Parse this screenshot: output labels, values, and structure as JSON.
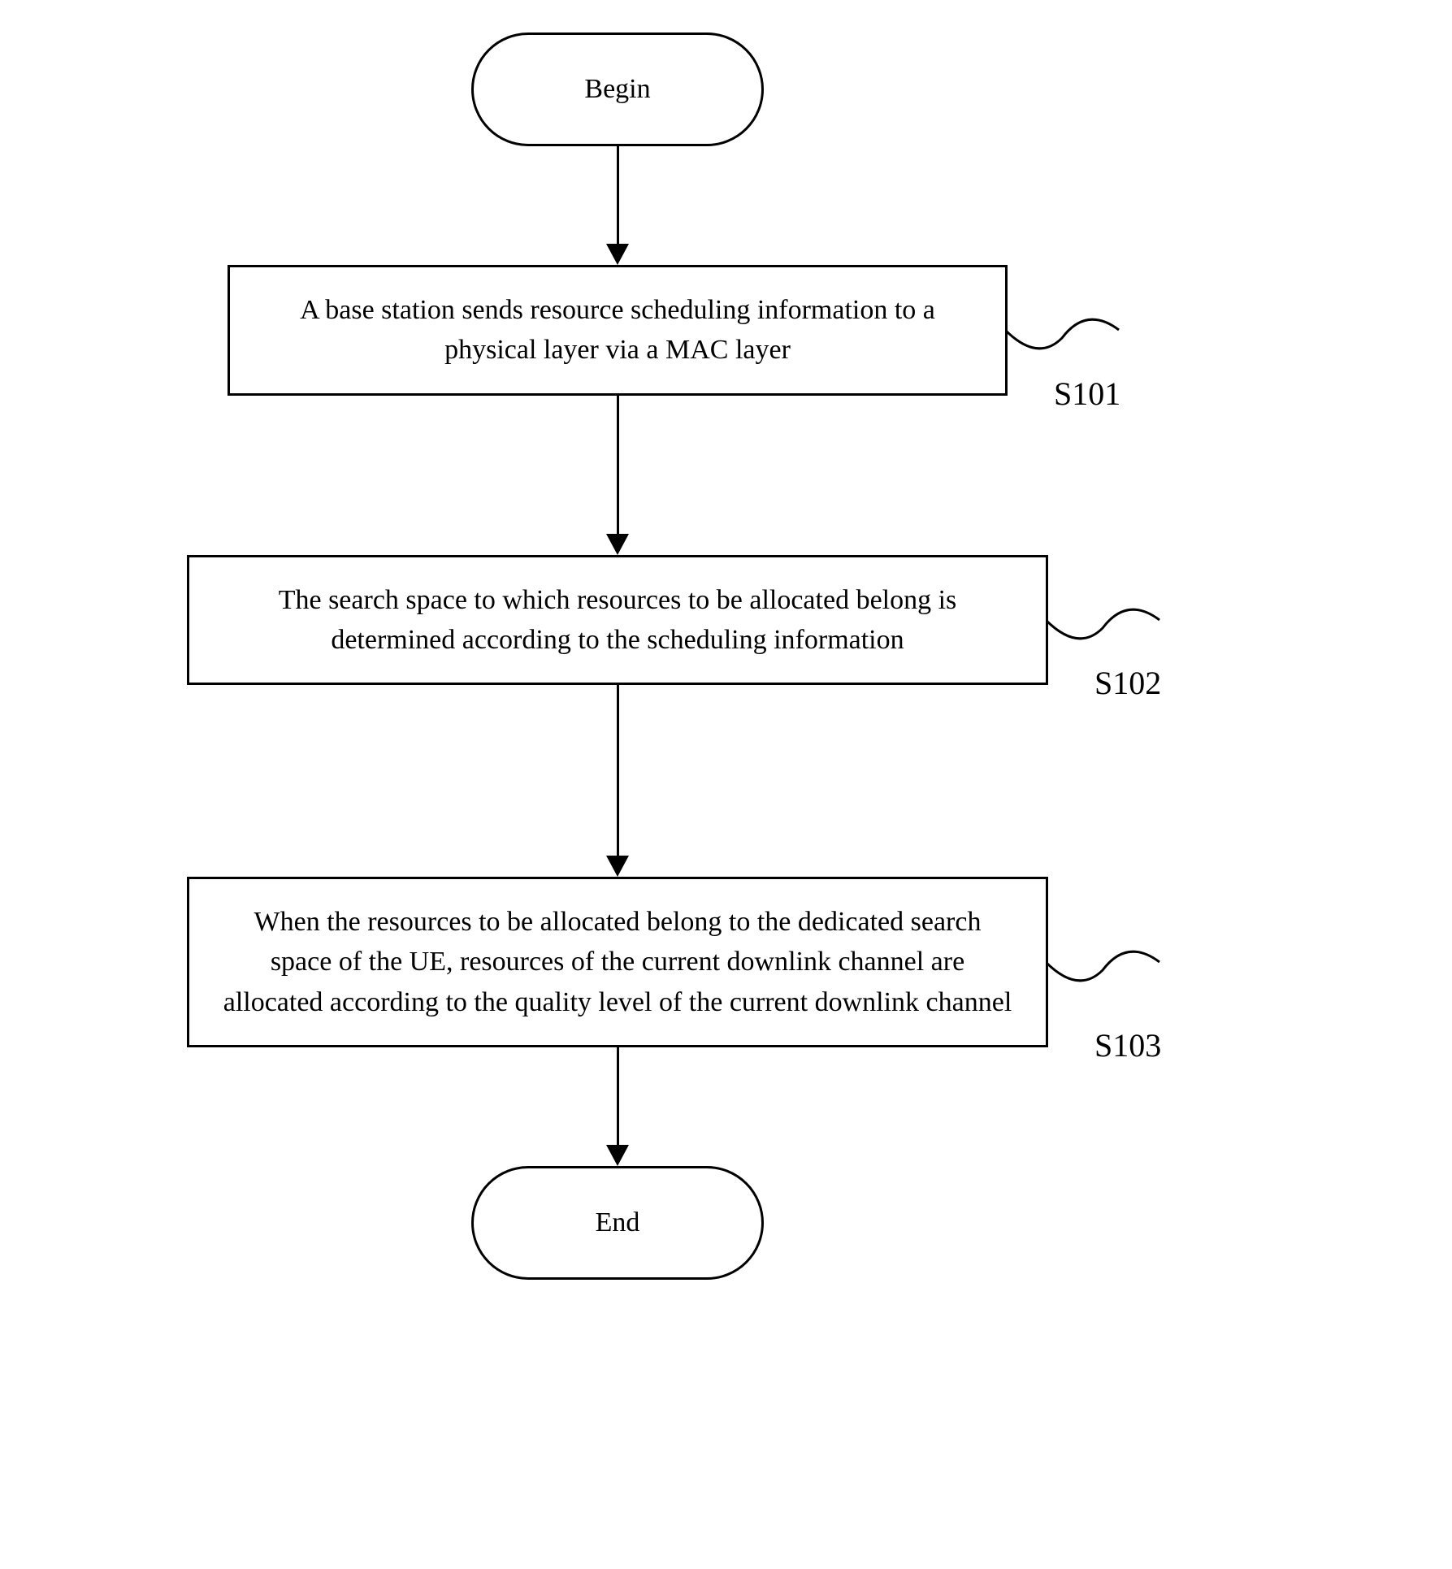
{
  "flow": {
    "begin": "Begin",
    "end": "End",
    "steps": [
      {
        "id": "S101",
        "text": "A base station sends resource scheduling information to a physical layer via a MAC layer"
      },
      {
        "id": "S102",
        "text": "The search space to which resources to be allocated belong is determined according to the scheduling information"
      },
      {
        "id": "S103",
        "text": "When the resources to be allocated belong to the dedicated search space of the UE, resources of the current downlink channel are allocated according to the quality level of the current downlink channel"
      }
    ]
  }
}
